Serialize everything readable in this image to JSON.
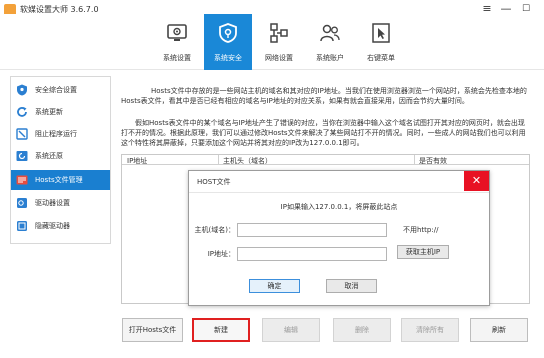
{
  "window": {
    "title": "软媒设置大师 3.6.7.0",
    "controls": [
      "≡",
      "—",
      "☐"
    ]
  },
  "toolbar": {
    "items": [
      {
        "label": "系统设置",
        "icon": "monitor-gear-icon"
      },
      {
        "label": "系统安全",
        "icon": "shield-icon",
        "active": true
      },
      {
        "label": "网络设置",
        "icon": "network-icon"
      },
      {
        "label": "系统账户",
        "icon": "user-accounts-icon"
      },
      {
        "label": "右键菜单",
        "icon": "cursor-icon"
      }
    ]
  },
  "sidebar": {
    "items": [
      {
        "label": "安全综合设置",
        "icon": "shield-icon"
      },
      {
        "label": "系统更新",
        "icon": "refresh-icon"
      },
      {
        "label": "阻止程序运行",
        "icon": "block-icon"
      },
      {
        "label": "系统还原",
        "icon": "restore-icon"
      },
      {
        "label": "Hosts文件管理",
        "icon": "hosts-icon",
        "active": true
      },
      {
        "label": "驱动器设置",
        "icon": "drive-icon"
      },
      {
        "label": "隐藏驱动器",
        "icon": "hidden-drive-icon"
      }
    ]
  },
  "main": {
    "desc1": "Hosts文件中存放的是一些网站主机的域名和其对应的IP地址。当我们在使用浏览器浏览一个网站时，系统会先检查本地的Hosts表文件，看其中是否已经有相应的域名与IP地址的对应关系，如果有就会直接采用，因而会节约大量时间。",
    "desc2": "假如Hosts表文件中的某个域名与IP地址产生了错误的对应，当你在浏览器中输入这个域名试图打开其对应的网页时，就会出现打不开的情况。根据此原理，我们可以通过修改Hosts文件来解决了某些网站打不开的情况。同时，一些成人的网站我们也可以利用这个特性将其屏蔽掉，只要添加这个网站并将其对应的IP改为127.0.0.1即可。",
    "table": {
      "columns": [
        "IP地址",
        "主机头（域名）",
        "是否有效"
      ]
    },
    "buttons": {
      "open": "打开Hosts文件",
      "new": "新建",
      "edit": "编辑",
      "delete": "删除",
      "clear_all": "清除所有",
      "refresh": "刷新"
    }
  },
  "dialog": {
    "title": "HOST文件",
    "close": "✕",
    "hint": "IP如果输入127.0.0.1，将屏蔽此站点",
    "host_label": "主机(域名)：",
    "host_value": "",
    "host_note": "不用http://",
    "ip_label": "IP地址：",
    "ip_value": "",
    "get_ip": "获取主机IP",
    "ok": "确定",
    "cancel": "取消"
  },
  "colors": {
    "accent": "#1a88d7",
    "highlight_border": "#e02020",
    "close_red": "#e81123"
  }
}
